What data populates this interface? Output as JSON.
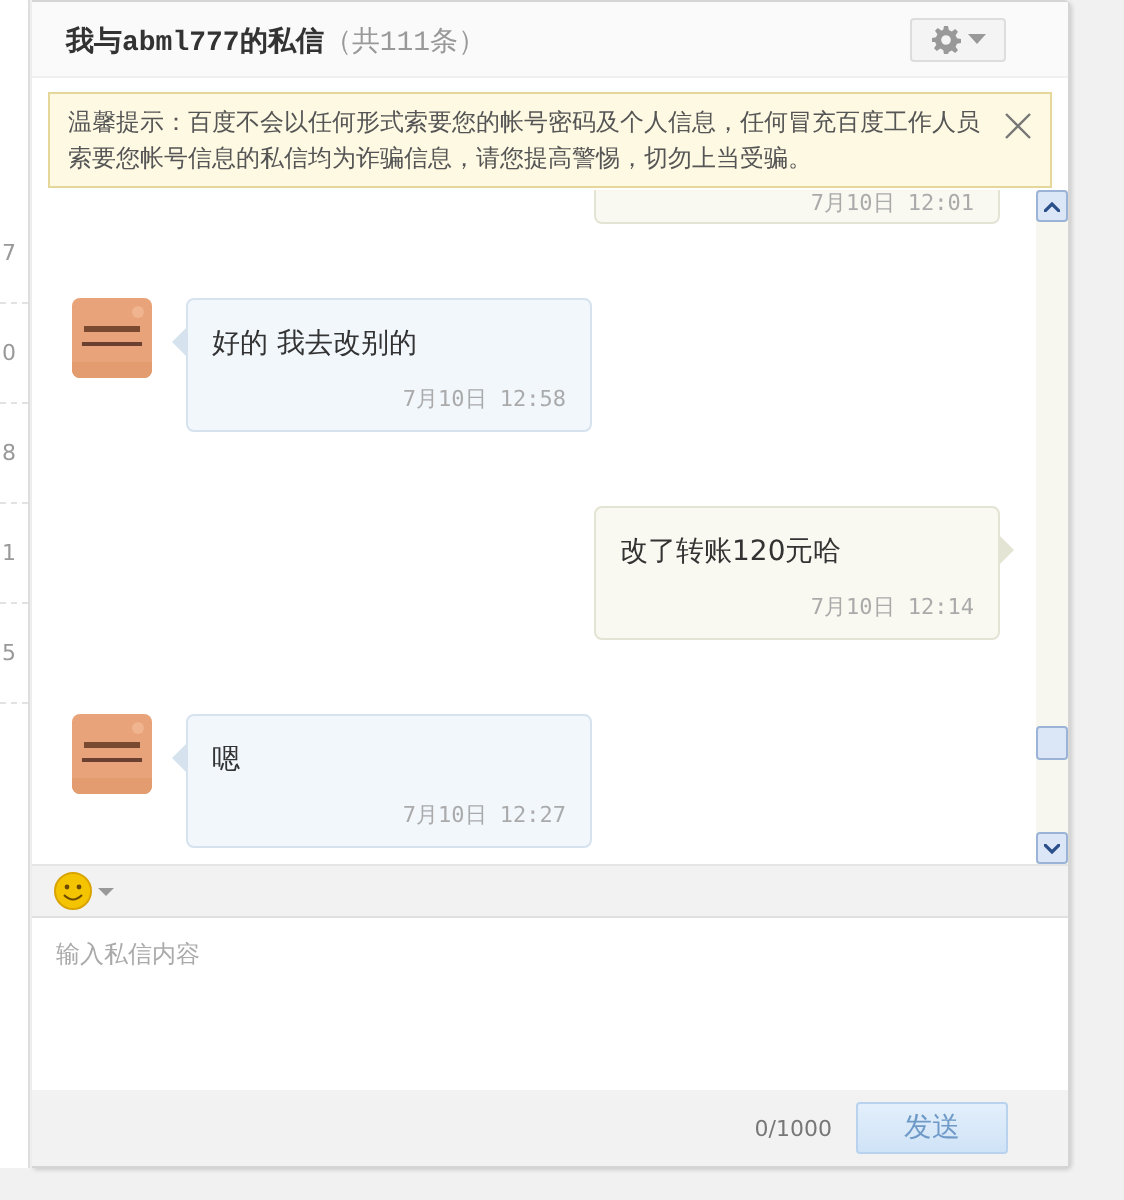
{
  "sidebar": {
    "items": [
      "7",
      "0",
      "8",
      "1",
      "5"
    ]
  },
  "header": {
    "title": "我与abml777的私信",
    "count": "（共111条）"
  },
  "notice": {
    "text": "温馨提示：百度不会以任何形式索要您的帐号密码及个人信息，任何冒充百度工作人员索要您帐号信息的私信均为诈骗信息，请您提高警惕，切勿上当受骗。"
  },
  "messages": [
    {
      "kind": "stub",
      "outgoing": true,
      "time": "7月10日 12:01"
    },
    {
      "kind": "full",
      "outgoing": false,
      "text": "好的 我去改别的",
      "time": "7月10日 12:58"
    },
    {
      "kind": "full",
      "outgoing": true,
      "text": "改了转账120元哈",
      "time": "7月10日 12:14"
    },
    {
      "kind": "full",
      "outgoing": false,
      "text": "嗯",
      "time": "7月10日 12:27"
    }
  ],
  "composer": {
    "placeholder": "输入私信内容",
    "counter": "0/1000",
    "send": "发送",
    "send_disabled": true
  }
}
